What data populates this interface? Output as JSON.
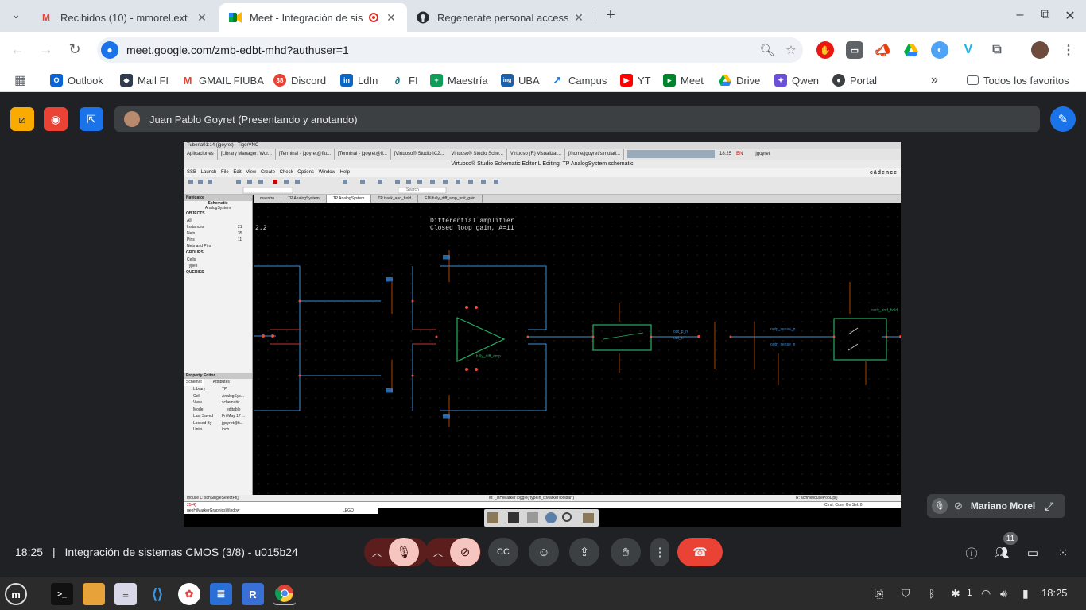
{
  "browser": {
    "tabs": [
      {
        "title": "Recibidos (10) - mmorel.ext",
        "icon": "gmail-icon"
      },
      {
        "title": "Meet - Integración de sis",
        "icon": "meet-icon",
        "active": true,
        "recording": true
      },
      {
        "title": "Regenerate personal access",
        "icon": "github-icon"
      }
    ],
    "new_tab": "+",
    "url": "meet.google.com/zmb-edbt-mhd?authuser=1",
    "bookmarks": [
      "Outlook",
      "Mail FI",
      "GMAIL FIUBA",
      "Discord",
      "LdIn",
      "FI",
      "Maestría",
      "UBA",
      "Campus",
      "YT",
      "Meet",
      "Drive",
      "Qwen",
      "Portal"
    ],
    "discord_badge": "38",
    "more_bookmarks": "»",
    "all_favorites": "Todos los favoritos"
  },
  "meet": {
    "presenter_banner": "Juan Pablo Goyret (Presentando y anotando)",
    "participant_tile": "Mariano Morel",
    "time": "18:25",
    "separator": "|",
    "meeting_title": "Integración de sistemas CMOS (3/8) - u015b24",
    "participant_count": "11"
  },
  "shared_screen": {
    "vnc_title": "Tuberia01:14 (jgoyret) - TigerVNC",
    "vnc_tasks": [
      "Aplicaciones",
      "[Library Manager: Wor...",
      "[Terminal - jgoyret@fiu...",
      "[Terminal - jgoyret@fi...",
      "[Virtuoso® Studio IC2...",
      "Virtuoso® Studio Sche...",
      "Virtuoso (R) Visualizat...",
      "[/home/jgoyret/simulati..."
    ],
    "vnc_clock": "18:25",
    "vnc_lang": "EN",
    "vnc_user": "jgoyret",
    "window_title": "Virtuoso® Studio Schematic Editor L Editing: TP AnalogSystem schematic",
    "menu": "SSB  Launch  File  Edit  View  Create  Check  Options  Window  Help",
    "brand": "cādence",
    "search_box": "Search",
    "doc_tabs": [
      "maestro",
      "TP AnalogSystem",
      "TP AnalogSystem",
      "TP track_and_hold",
      "EDI fully_diff_amp_unit_gain"
    ],
    "navigator_title": "Navigator",
    "navigator_view": "Schematic",
    "navigator_cell": "AnalogSystem",
    "objects_label": "OBJECTS",
    "objects": [
      {
        "name": "All",
        "count": ""
      },
      {
        "name": "Instances",
        "count": "21"
      },
      {
        "name": "Nets",
        "count": "35"
      },
      {
        "name": "Pins",
        "count": "11"
      },
      {
        "name": "Nets and Pins",
        "count": ""
      }
    ],
    "groups_label": "GROUPS",
    "groups": [
      "Cells",
      "Types"
    ],
    "queries_label": "QUERIES",
    "property_editor_title": "Property Editor",
    "prop_tabs": [
      "Schemat",
      "Attributes"
    ],
    "props": [
      {
        "k": "Library",
        "v": "TP"
      },
      {
        "k": "Cell",
        "v": "AnalogSys..."
      },
      {
        "k": "View",
        "v": "schematic"
      },
      {
        "k": "Mode",
        "v": "editable"
      },
      {
        "k": "Last Saved",
        "v": "Fri May 17 ..."
      },
      {
        "k": "Locked By",
        "v": "jgoyret@fi..."
      },
      {
        "k": "Units",
        "v": "inch"
      }
    ],
    "canvas_label_1": "Differential amplifier",
    "canvas_label_2": "Closed loop gain, A=11",
    "canvas_corner": "2.2",
    "canvas_amp_label": "fully_diff_amp",
    "canvas_net_1": "out_p_n",
    "canvas_net_2": "out_n",
    "canvas_net_3": "outp_sense_p",
    "canvas_net_4": "outn_sense_n",
    "canvas_block": "track_and_hold",
    "status_left": "mouse L: schSingleSelectPt()",
    "status_mid": "M: _lxHiMarkerToggle(\"typeIn_lxMarkerToolbar\")",
    "status_right": "R: schHiMousePopUp()",
    "cmd_prompt": "25(4)",
    "cmd_right": "Cmd:  Conn  On  Sel: 0",
    "cmd_line2": "geoHiMarkerGraphicsWindow",
    "cmd_line2_val": "LEGO"
  },
  "os": {
    "clock": "18:25",
    "notif_count": "1"
  }
}
